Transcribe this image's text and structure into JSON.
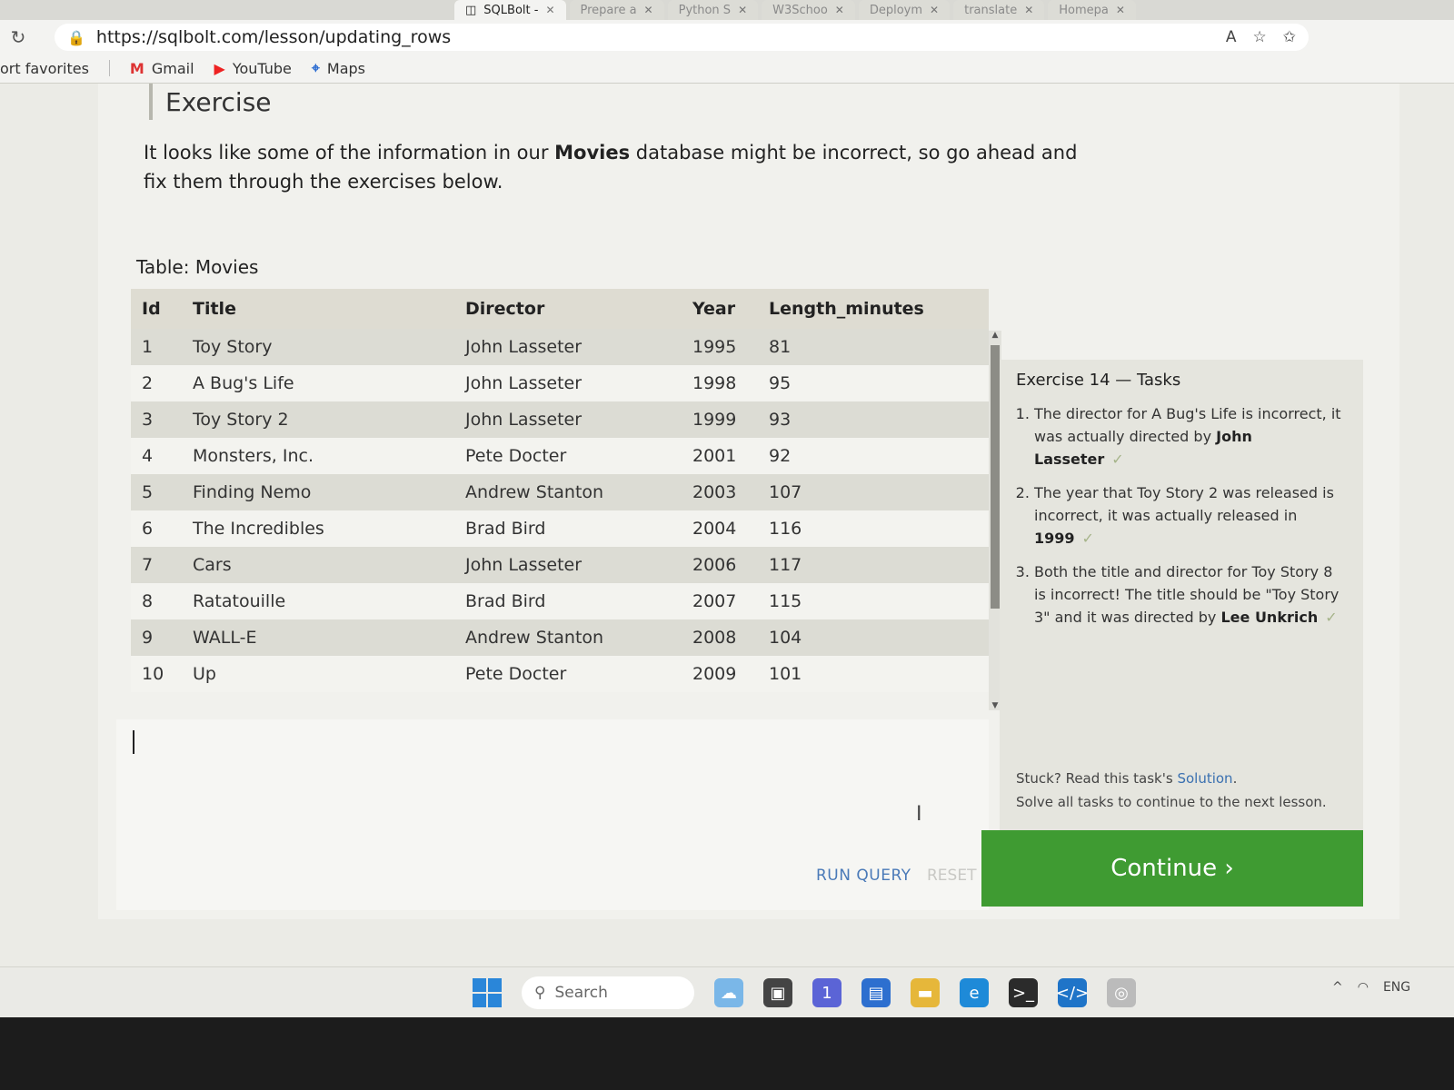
{
  "browser": {
    "tabs": [
      {
        "label": "SQLBolt -",
        "active": true
      },
      {
        "label": "Prepare a",
        "active": false
      },
      {
        "label": "Python S",
        "active": false
      },
      {
        "label": "W3Schoo",
        "active": false
      },
      {
        "label": "Deploym",
        "active": false
      },
      {
        "label": "translate",
        "active": false
      },
      {
        "label": "Homepa",
        "active": false
      }
    ],
    "url": "https://sqlbolt.com/lesson/updating_rows",
    "favorites_label": "ort favorites",
    "favorites": [
      "Gmail",
      "YouTube",
      "Maps"
    ]
  },
  "exercise": {
    "heading": "Exercise",
    "intro_before": "It looks like some of the information in our ",
    "intro_bold": "Movies",
    "intro_after": " database might be incorrect, so go ahead and fix them through the exercises below."
  },
  "table": {
    "label": "Table: Movies",
    "headers": [
      "Id",
      "Title",
      "Director",
      "Year",
      "Length_minutes"
    ],
    "rows": [
      [
        "1",
        "Toy Story",
        "John Lasseter",
        "1995",
        "81"
      ],
      [
        "2",
        "A Bug's Life",
        "John Lasseter",
        "1998",
        "95"
      ],
      [
        "3",
        "Toy Story 2",
        "John Lasseter",
        "1999",
        "93"
      ],
      [
        "4",
        "Monsters, Inc.",
        "Pete Docter",
        "2001",
        "92"
      ],
      [
        "5",
        "Finding Nemo",
        "Andrew Stanton",
        "2003",
        "107"
      ],
      [
        "6",
        "The Incredibles",
        "Brad Bird",
        "2004",
        "116"
      ],
      [
        "7",
        "Cars",
        "John Lasseter",
        "2006",
        "117"
      ],
      [
        "8",
        "Ratatouille",
        "Brad Bird",
        "2007",
        "115"
      ],
      [
        "9",
        "WALL-E",
        "Andrew Stanton",
        "2008",
        "104"
      ],
      [
        "10",
        "Up",
        "Pete Docter",
        "2009",
        "101"
      ]
    ]
  },
  "editor": {
    "run_label": "RUN QUERY",
    "reset_label": "RESET"
  },
  "tasks": {
    "title": "Exercise 14 — Tasks",
    "items": [
      {
        "pre": "The director for A Bug's Life is incorrect, it was actually directed by ",
        "bold": "John Lasseter",
        "done": true
      },
      {
        "pre": "The year that Toy Story 2 was released is incorrect, it was actually released in ",
        "bold": "1999",
        "done": true
      },
      {
        "pre": "Both the title and director for Toy Story 8 is incorrect! The title should be \"Toy Story 3\" and it was directed by ",
        "bold": "Lee Unkrich",
        "done": true
      }
    ],
    "check": "✓",
    "stuck_pre": "Stuck? Read this task's ",
    "stuck_link": "Solution",
    "stuck_post": ".",
    "solve_all": "Solve all tasks to continue to the next lesson.",
    "continue_label": "Continue ›"
  },
  "taskbar": {
    "search_placeholder": "Search",
    "language": "ENG",
    "notification_count": "1"
  },
  "colors": {
    "continue_green": "#3f9b32",
    "link_blue": "#3a70b0",
    "start_blue": "#2a86d9"
  }
}
